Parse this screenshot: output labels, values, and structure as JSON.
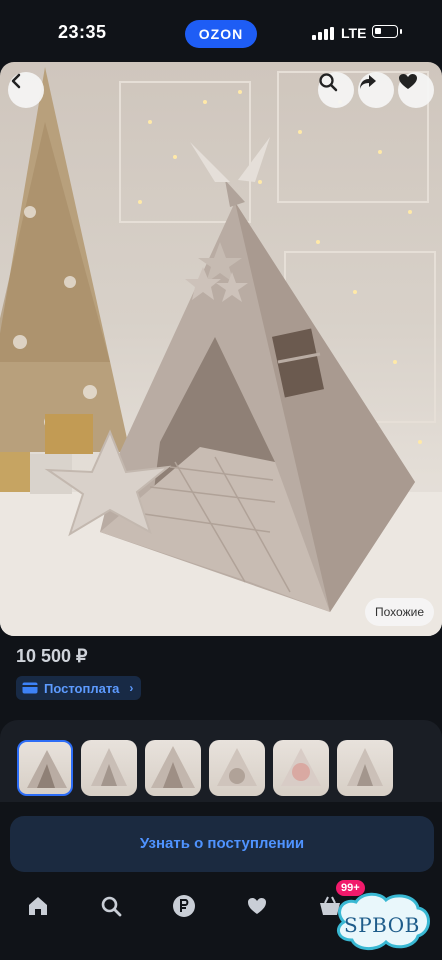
{
  "status_bar": {
    "time": "23:35",
    "app_badge": "OZON",
    "network": "LTE"
  },
  "product": {
    "price": "10 500 ₽",
    "payment_badge": "Постоплата",
    "similar_label": "Похожие"
  },
  "gallery": {
    "thumbnail_count": 6,
    "active_index": 0
  },
  "actions": {
    "notify_label": "Узнать о поступлении"
  },
  "nav": {
    "items": [
      "home-icon",
      "search-icon",
      "ruble-icon",
      "heart-icon",
      "cart-icon",
      "ozon-icon"
    ],
    "cart_badge": "99+"
  },
  "watermark": {
    "text": "SPBOB"
  },
  "colors": {
    "accent": "#1e5df5",
    "badge": "#f11a6b",
    "background": "#101318"
  }
}
